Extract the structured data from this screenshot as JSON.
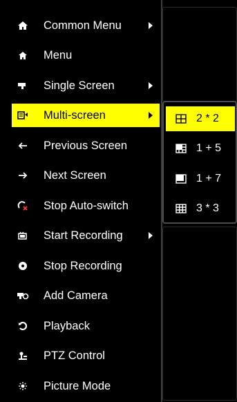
{
  "main_menu": {
    "items": [
      {
        "label": "Common Menu",
        "icon": "home-gear-icon",
        "has_submenu": true
      },
      {
        "label": "Menu",
        "icon": "home-icon",
        "has_submenu": false
      },
      {
        "label": "Single Screen",
        "icon": "camera-icon",
        "has_submenu": true
      },
      {
        "label": "Multi-screen",
        "icon": "multi-screen-icon",
        "has_submenu": true,
        "selected": true
      },
      {
        "label": "Previous Screen",
        "icon": "arrow-left-icon",
        "has_submenu": false
      },
      {
        "label": "Next Screen",
        "icon": "arrow-right-icon",
        "has_submenu": false
      },
      {
        "label": "Stop Auto-switch",
        "icon": "stop-auto-switch-icon",
        "has_submenu": false
      },
      {
        "label": "Start Recording",
        "icon": "record-icon",
        "has_submenu": true
      },
      {
        "label": "Stop Recording",
        "icon": "stop-record-icon",
        "has_submenu": false
      },
      {
        "label": "Add Camera",
        "icon": "add-camera-icon",
        "has_submenu": false
      },
      {
        "label": "Playback",
        "icon": "playback-icon",
        "has_submenu": false
      },
      {
        "label": "PTZ Control",
        "icon": "ptz-icon",
        "has_submenu": false
      },
      {
        "label": "Picture Mode",
        "icon": "picture-mode-icon",
        "has_submenu": false
      }
    ]
  },
  "submenu": {
    "items": [
      {
        "label": "2 * 2",
        "icon": "layout-2x2-icon",
        "selected": true
      },
      {
        "label": "1 + 5",
        "icon": "layout-1plus5-icon"
      },
      {
        "label": "1 + 7",
        "icon": "layout-1plus7-icon"
      },
      {
        "label": "3 * 3",
        "icon": "layout-3x3-icon"
      }
    ]
  },
  "colors": {
    "highlight": "#ffff00",
    "background": "#000000",
    "text": "#ffffff"
  }
}
